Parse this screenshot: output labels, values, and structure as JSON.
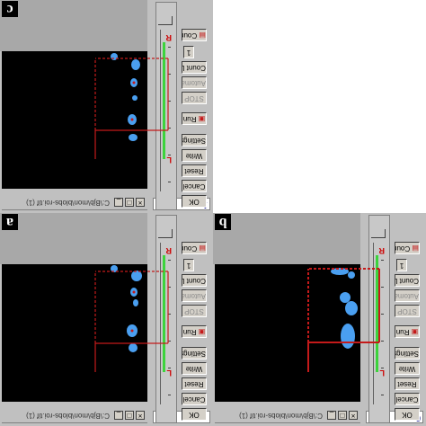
{
  "colors": {
    "roi": "#c41a1a",
    "blob": "#4a9ff0",
    "slider_green": "#3cd43c",
    "status_text": "#000080"
  },
  "panels": [
    {
      "id": "c",
      "label": "c",
      "status_value": "1",
      "title": "C:\\Bjb\\mon\\blobs-roi.tif (1)",
      "buttons": [
        "OK",
        "Cancel",
        "Reset",
        "Write",
        "Settings",
        "Run",
        "STOP",
        "Automatic",
        "Count Lab",
        "Count Pos"
      ],
      "step_label": "1",
      "slider_marks": [
        "R",
        "L"
      ]
    },
    {
      "id": "a",
      "label": "a",
      "status_value": "",
      "title": "C:\\Bjb\\mon\\blobs-roi.tif (1)",
      "buttons": [
        "OK",
        "Cancel",
        "Reset",
        "Write",
        "Settings",
        "Run",
        "STOP",
        "Automatic",
        "Count Lab",
        "Count Pos"
      ],
      "step_label": "1",
      "slider_marks": [
        "R",
        "L"
      ]
    },
    {
      "id": "b",
      "label": "b",
      "status_value": "0",
      "title": "C:\\Bjb\\mon\\blobs-roi.tif (1)",
      "buttons": [
        "OK",
        "Cancel",
        "Reset",
        "Write",
        "Settings",
        "Run",
        "STOP",
        "Automatic",
        "Count Lab",
        "Count Pos"
      ],
      "step_label": "1",
      "slider_marks": [
        "R",
        "L"
      ]
    }
  ],
  "icons": {
    "minimize": "minimize-icon",
    "maximize": "maximize-icon",
    "close": "close-icon",
    "file": "file-icon",
    "run": "run-icon"
  },
  "window_controls": {
    "min": "_",
    "max": "□",
    "close": "×"
  }
}
